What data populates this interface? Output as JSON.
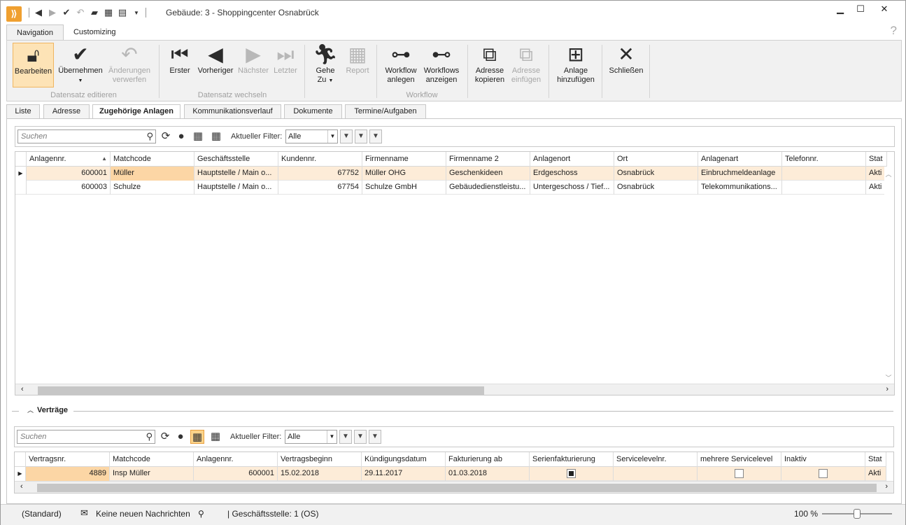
{
  "window": {
    "title": "Gebäude: 3 - Shoppingcenter Osnabrück",
    "minimize": "▁",
    "maximize": "☐",
    "close": "✕",
    "help": "?"
  },
  "qat": {
    "icons": [
      "back-icon",
      "forward-icon",
      "check-icon",
      "undo-icon",
      "chat-icon",
      "calendar-icon",
      "list-icon",
      "dropdown-icon"
    ]
  },
  "menu_tabs": [
    {
      "label": "Navigation",
      "active": true
    },
    {
      "label": "Customizing",
      "active": false
    }
  ],
  "ribbon": {
    "groups": [
      "Datensatz editieren",
      "Datensatz wechseln",
      "Workflow"
    ],
    "buttons": [
      {
        "label": "Bearbeiten",
        "icon": "lock-icon",
        "state": "pressed"
      },
      {
        "label": "Übernehmen",
        "icon": "check-icon",
        "state": "normal"
      },
      {
        "label": "Änderungen verwerfen",
        "line1": "Änderungen",
        "line2": "verwerfen",
        "icon": "undo-icon",
        "state": "disabled"
      },
      {
        "label": "Erster",
        "icon": "first-icon",
        "state": "normal"
      },
      {
        "label": "Vorheriger",
        "icon": "previous-icon",
        "state": "normal"
      },
      {
        "label": "Nächster",
        "icon": "next-icon",
        "state": "disabled"
      },
      {
        "label": "Letzter",
        "icon": "last-icon",
        "state": "disabled"
      },
      {
        "label": "Gehe Zu",
        "line1": "Gehe",
        "line2": "Zu",
        "icon": "running-man-icon",
        "state": "normal"
      },
      {
        "label": "Report",
        "icon": "report-icon",
        "state": "disabled"
      },
      {
        "label": "Workflow anlegen",
        "line1": "Workflow",
        "line2": "anlegen",
        "icon": "workflow-icon",
        "state": "normal"
      },
      {
        "label": "Workflows anzeigen",
        "line1": "Workflows",
        "line2": "anzeigen",
        "icon": "workflow-clock-icon",
        "state": "normal"
      },
      {
        "label": "Adresse kopieren",
        "line1": "Adresse",
        "line2": "kopieren",
        "icon": "copy-address-icon",
        "state": "normal"
      },
      {
        "label": "Adresse einfügen",
        "line1": "Adresse",
        "line2": "einfügen",
        "icon": "paste-address-icon",
        "state": "disabled"
      },
      {
        "label": "Anlage hinzufügen",
        "line1": "Anlage",
        "line2": "hinzufügen",
        "icon": "add-system-icon",
        "state": "normal"
      },
      {
        "label": "Schließen",
        "icon": "close-icon",
        "state": "normal"
      }
    ]
  },
  "page_tabs": [
    {
      "label": "Liste",
      "active": false
    },
    {
      "label": "Adresse",
      "active": false
    },
    {
      "label": "Zugehörige Anlagen",
      "active": true
    },
    {
      "label": "Kommunikationsverlauf",
      "active": false
    },
    {
      "label": "Dokumente",
      "active": false
    },
    {
      "label": "Termine/Aufgaben",
      "active": false
    }
  ],
  "filter1": {
    "search_placeholder": "Suchen",
    "filter_label": "Aktueller Filter:",
    "filter_value": "Alle"
  },
  "grid1": {
    "columns": [
      "Anlagennr.",
      "Matchcode",
      "Geschäftsstelle",
      "Kundennr.",
      "Firmenname",
      "Firmenname 2",
      "Anlagenort",
      "Ort",
      "Anlagenart",
      "Telefonnr.",
      "Stat"
    ],
    "rows": [
      [
        "600001",
        "Müller",
        "Hauptstelle / Main o...",
        "67752",
        "Müller OHG",
        "Geschenkideen",
        "Erdgeschoss",
        "Osnabrück",
        "Einbruchmeldeanlage",
        "",
        "Akti"
      ],
      [
        "600003",
        "Schulze",
        "Hauptstelle / Main o...",
        "67754",
        "Schulze GmbH",
        "Gebäudedienstleistu...",
        "Untergeschoss / Tief...",
        "Osnabrück",
        "Telekommunikations...",
        "",
        "Akti"
      ]
    ]
  },
  "section": {
    "label": "Verträge",
    "toggle": "^"
  },
  "filter2": {
    "search_placeholder": "Suchen",
    "filter_label": "Aktueller Filter:",
    "filter_value": "Alle"
  },
  "grid2": {
    "columns": [
      "Vertragsnr.",
      "Matchcode",
      "Anlagennr.",
      "Vertragsbeginn",
      "Kündigungsdatum",
      "Fakturierung ab",
      "Serienfakturierung",
      "Servicelevelnr.",
      "mehrere Servicelevel",
      "Inaktiv",
      "Stat"
    ],
    "rows": [
      {
        "vertragsnr": "4889",
        "matchcode": "Insp Müller",
        "anlagennr": "600001",
        "beginn": "15.02.2018",
        "kuendigung": "29.11.2017",
        "fakturierung": "01.03.2018",
        "serien": true,
        "servicelevelnr": "",
        "mehrere": false,
        "inaktiv": false,
        "status": "Akti"
      }
    ]
  },
  "statusbar": {
    "profile": "(Standard)",
    "messages": "Keine neuen Nachrichten",
    "office": "| Geschäftsstelle:  1 (OS)",
    "zoom": "100 %",
    "zoom_value": 50
  }
}
